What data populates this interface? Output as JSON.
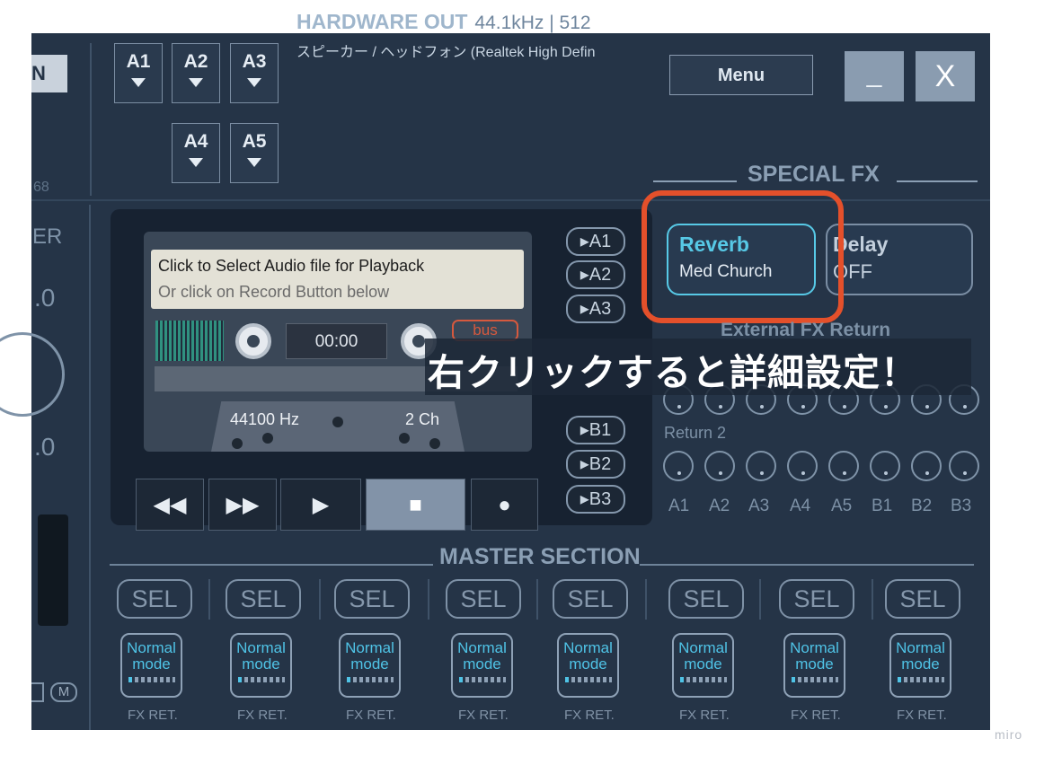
{
  "header": {
    "hw_title": "HARDWARE OUT",
    "hw_rate": "44.1kHz | 512",
    "hw_device": "スピーカー / ヘッドフォン (Realtek High Defin",
    "menu_label": "Menu",
    "minimize_label": "_",
    "close_label": "X",
    "partial_top_left": "N",
    "left_number": "68",
    "bus_buttons": [
      "A1",
      "A2",
      "A3",
      "A4",
      "A5"
    ]
  },
  "left_strip": {
    "label": "ER",
    "value1": ".0",
    "value2": ".0",
    "mute": "M"
  },
  "player": {
    "line1": "Click to Select Audio file for Playback",
    "line2": "Or click on Record Button below",
    "time": "00:00",
    "bus_tag": "bus",
    "sample_rate": "44100 Hz",
    "channels": "2 Ch",
    "transport": [
      "◀◀",
      "▶▶",
      "▶",
      "■",
      "●"
    ],
    "routes_a": [
      "▸A1",
      "▸A2",
      "▸A3"
    ],
    "routes_b": [
      "▸B1",
      "▸B2",
      "▸B3"
    ]
  },
  "special_fx": {
    "title": "SPECIAL FX",
    "reverb_name": "Reverb",
    "reverb_value": "Med Church",
    "delay_name": "Delay",
    "delay_value": "OFF",
    "external_title": "External FX Return",
    "return2": "Return 2",
    "labels": [
      "A1",
      "A2",
      "A3",
      "A4",
      "A5",
      "B1",
      "B2",
      "B3"
    ]
  },
  "annotation": "右クリックすると詳細設定！",
  "master": {
    "title": "MASTER SECTION",
    "sel_label": "SEL",
    "mode_line1": "Normal",
    "mode_line2": "mode",
    "fx_ret": "FX RET."
  },
  "watermark": "miro",
  "colors": {
    "accent_cyan": "#57c9e6",
    "highlight_red": "#e4502b",
    "panel_bg": "#253447"
  }
}
